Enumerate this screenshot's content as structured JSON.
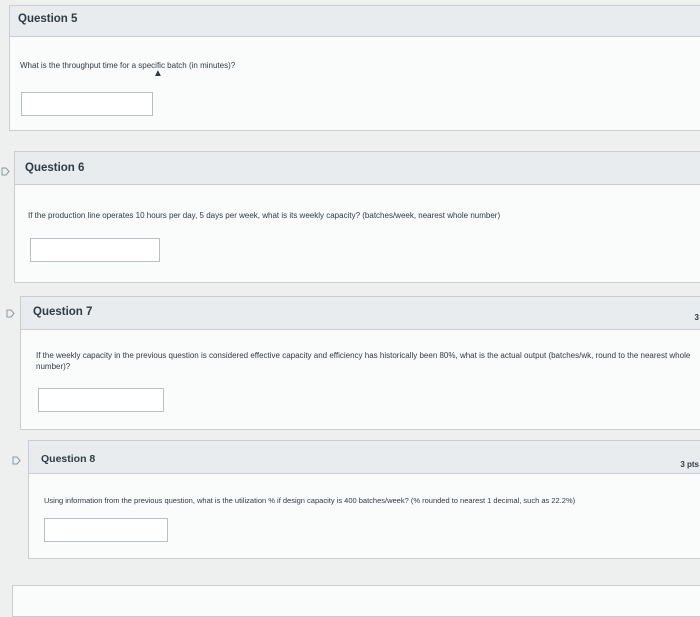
{
  "q5": {
    "title": "Question 5",
    "text": "What is the throughput time for a specific batch (in minutes)?",
    "answer": ""
  },
  "q6": {
    "title": "Question 6",
    "text": "If the production line operates 10 hours per day, 5 days per week, what is its weekly capacity? (batches/week, nearest whole number)",
    "answer": ""
  },
  "q7": {
    "title": "Question 7",
    "text": "If the weekly capacity in the previous question is considered effective capacity and efficiency has historically been 80%, what is the actual output (batches/wk, round to the nearest whole number)?",
    "points": "3",
    "answer": ""
  },
  "q8": {
    "title": "Question 8",
    "text": "Using information from the previous question, what is the utilization % if design capacity is 400 batches/week? (% rounded to nearest 1 decimal, such as 22.2%)",
    "points": "3 pts",
    "answer": ""
  },
  "icons": {
    "flag": "flag-icon",
    "cursor": "mouse-cursor-icon"
  }
}
